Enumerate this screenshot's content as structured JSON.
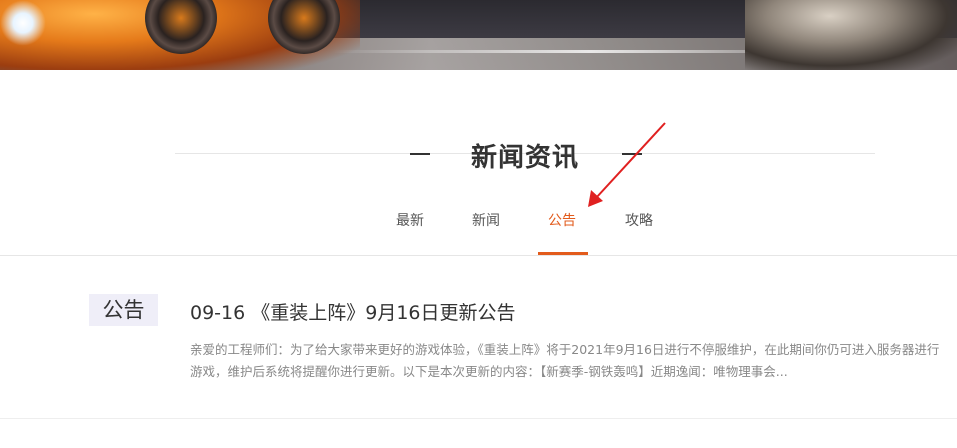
{
  "section": {
    "title": "新闻资讯"
  },
  "tabs": [
    {
      "label": "最新",
      "active": false
    },
    {
      "label": "新闻",
      "active": false
    },
    {
      "label": "公告",
      "active": true
    },
    {
      "label": "攻略",
      "active": false
    }
  ],
  "news": [
    {
      "category": "公告",
      "title": "09-16 《重装上阵》9月16日更新公告",
      "summary": "亲爱的工程师们：为了给大家带来更好的游戏体验，《重装上阵》将于2021年9月16日进行不停服维护，在此期间你仍可进入服务器进行游戏，维护后系统将提醒你进行更新。以下是本次更新的内容：【新赛季-钢铁轰鸣】近期逸闻：唯物理事会..."
    }
  ],
  "colors": {
    "accent": "#e25b1c",
    "annotation_arrow": "#e02020",
    "badge_bg": "#efeef8"
  }
}
